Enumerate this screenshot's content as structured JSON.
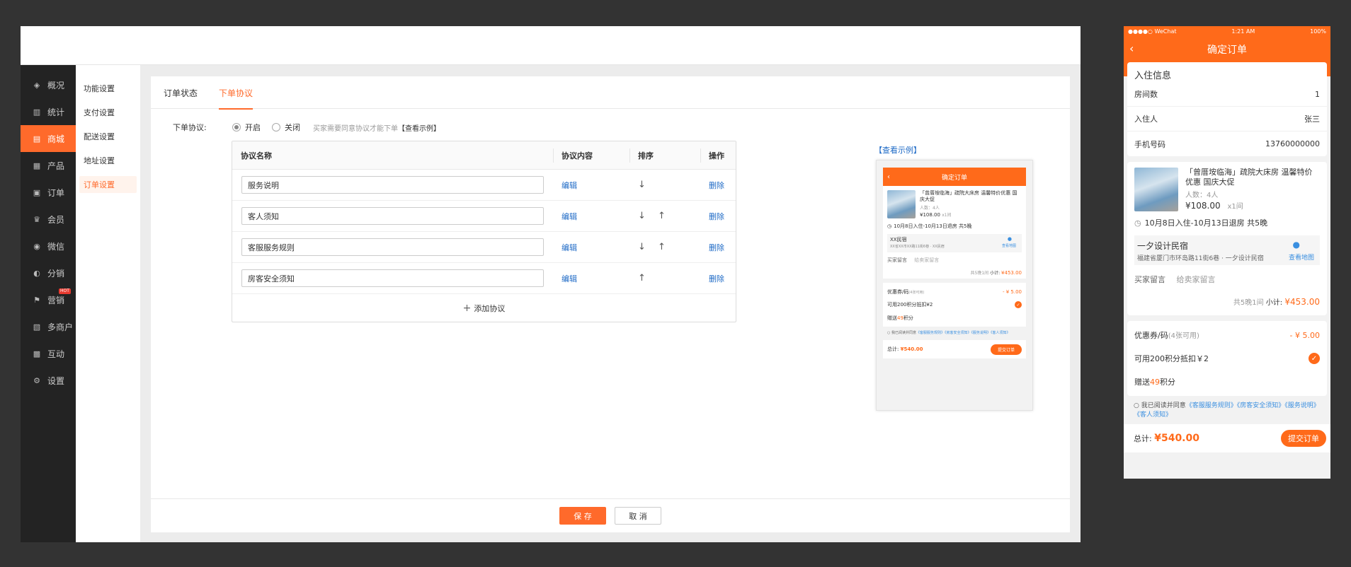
{
  "sidebar": {
    "items": [
      {
        "label": "概况",
        "icon": "layers-icon",
        "glyph": "◈"
      },
      {
        "label": "统计",
        "icon": "chart-icon",
        "glyph": "▥"
      },
      {
        "label": "商城",
        "icon": "shop-icon",
        "glyph": "▤"
      },
      {
        "label": "产品",
        "icon": "grid-icon",
        "glyph": "▦"
      },
      {
        "label": "订单",
        "icon": "order-icon",
        "glyph": "▣"
      },
      {
        "label": "会员",
        "icon": "crown-icon",
        "glyph": "♛"
      },
      {
        "label": "微信",
        "icon": "wechat-icon",
        "glyph": "◉"
      },
      {
        "label": "分销",
        "icon": "users-icon",
        "glyph": "◐"
      },
      {
        "label": "营销",
        "icon": "flag-icon",
        "glyph": "⚑"
      },
      {
        "label": "多商户",
        "icon": "store-icon",
        "glyph": "▧"
      },
      {
        "label": "互动",
        "icon": "apps-icon",
        "glyph": "▩"
      },
      {
        "label": "设置",
        "icon": "gear-icon",
        "glyph": "⚙"
      }
    ],
    "hot_badge": "HOT"
  },
  "subnav": {
    "items": [
      "功能设置",
      "支付设置",
      "配送设置",
      "地址设置",
      "订单设置"
    ]
  },
  "tabs": [
    "订单状态",
    "下单协议"
  ],
  "form": {
    "label": "下单协议:",
    "on_label": "开启",
    "off_label": "关闭",
    "hint": "买家需要同意协议才能下单",
    "example_link": "【查看示例】"
  },
  "table": {
    "headers": {
      "name": "协议名称",
      "content": "协议内容",
      "sort": "排序",
      "action": "操作"
    },
    "rows": [
      {
        "name": "服务说明",
        "edit": "编辑",
        "delete": "删除",
        "down": "↓",
        "up": ""
      },
      {
        "name": "客人须知",
        "edit": "编辑",
        "delete": "删除",
        "down": "↓",
        "up": "↑"
      },
      {
        "name": "客服服务规则",
        "edit": "编辑",
        "delete": "删除",
        "down": "↓",
        "up": "↑"
      },
      {
        "name": "房客安全须知",
        "edit": "编辑",
        "delete": "删除",
        "down": "",
        "up": "↑"
      }
    ],
    "add_label": "添加协议"
  },
  "footer": {
    "save": "保 存",
    "cancel": "取 消"
  },
  "example_title": "【查看示例】",
  "mini": {
    "title": "确定订单",
    "hotel_name": "「曾厝垵临海」疏院大床房 温馨特价优惠 国庆大促",
    "people": "人数：4人",
    "price": "¥108.00",
    "qty": "x1间",
    "dates": "10月8日入住-10月13日退房 共5晚",
    "place": "XX民宿",
    "address": "XX省XX市XX路11街6巷 · XX民宿",
    "map": "查看地图",
    "msg_label": "买家留言",
    "msg_placeholder": "给卖家留言",
    "subtotal_prefix": "共5晚1间",
    "subtotal_label": "小计:",
    "subtotal": "¥453.00",
    "coupon_label": "优惠券/码",
    "coupon_count": "(4张可用)",
    "coupon_value": "- ¥ 5.00",
    "points_label": "可用200积分抵扣¥2",
    "bonus_prefix": "赠送",
    "bonus_num": "49",
    "bonus_suffix": "积分",
    "agree_prefix": "我已阅读并同意",
    "agree_links": "《客服服务规则》《房客安全须知》《服务说明》《客人须知》",
    "total_label": "总计:",
    "total": "¥540.00",
    "submit": "提交订单"
  },
  "phone": {
    "carrier": "●●●●○ WeChat",
    "time": "1:21 AM",
    "battery": "100%",
    "title": "确定订单",
    "checkin_title": "入住信息",
    "rooms_label": "房间数",
    "rooms_value": "1",
    "guest_label": "入住人",
    "guest_value": "张三",
    "phone_label": "手机号码",
    "phone_value": "13760000000",
    "hotel_name": "「曾厝垵临海」疏院大床房 温馨特价优惠 国庆大促",
    "people": "人数：4人",
    "price": "¥108.00",
    "qty": "x1间",
    "dates": "10月8日入住-10月13日退房  共5晚",
    "place": "一夕设计民宿",
    "address": "福建省厦门市环岛路11街6巷 · 一夕设计民宿",
    "map": "查看地图",
    "msg_label": "买家留言",
    "msg_placeholder": "给卖家留言",
    "subtotal_prefix": "共5晚1间",
    "subtotal_label": "小计:",
    "subtotal": "¥453.00",
    "coupon_label": "优惠券/码",
    "coupon_count": "(4张可用)",
    "coupon_value": "- ¥ 5.00",
    "points_label": "可用200积分抵扣￥2",
    "bonus_prefix": "赠送",
    "bonus_num": "49",
    "bonus_suffix": "积分",
    "agree_prefix": "我已阅读并同意",
    "agree_links": "《客服服务规则》《房客安全须知》《服务说明》《客人须知》",
    "total_label": "总计:",
    "total": "¥540.00",
    "submit": "提交订单"
  },
  "colors": {
    "accent": "#ff6a2b",
    "link": "#1e6ac6",
    "sidebar_bg": "#232323"
  }
}
